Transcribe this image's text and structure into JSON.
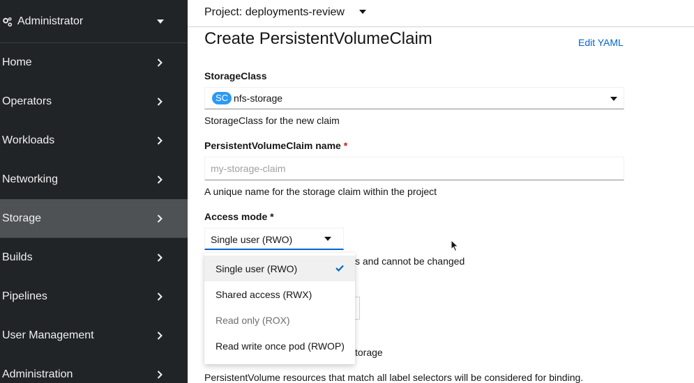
{
  "sidebar": {
    "perspective": {
      "label": "Administrator",
      "icon": "cog-icon"
    },
    "items": [
      {
        "label": "Home"
      },
      {
        "label": "Operators"
      },
      {
        "label": "Workloads"
      },
      {
        "label": "Networking"
      },
      {
        "label": "Storage",
        "active": true
      },
      {
        "label": "Builds"
      },
      {
        "label": "Pipelines"
      },
      {
        "label": "User Management"
      },
      {
        "label": "Administration"
      }
    ]
  },
  "topbar": {
    "project_label": "Project: deployments-review"
  },
  "page": {
    "title": "Create PersistentVolumeClaim",
    "edit_yaml": "Edit YAML"
  },
  "form": {
    "storage_class": {
      "label": "StorageClass",
      "badge": "SC",
      "value": "nfs-storage",
      "help": "StorageClass for the new claim"
    },
    "pvc_name": {
      "label": "PersistentVolumeClaim name",
      "required_mark": "*",
      "placeholder": "my-storage-claim",
      "help": "A unique name for the storage claim within the project"
    },
    "access_mode": {
      "label": "Access mode *",
      "value": "Single user (RWO)",
      "help_visible": "s and cannot be changed",
      "options": [
        {
          "label": "Single user (RWO)",
          "selected": true
        },
        {
          "label": "Shared access (RWX)"
        },
        {
          "label": "Read only (ROX)",
          "disabled": true
        },
        {
          "label": "Read write once pod (RWOP)"
        }
      ]
    },
    "partial_storage_text": "torage",
    "selector_help": "PersistentVolume resources that match all label selectors will be considered for binding."
  },
  "colors": {
    "sidebar_bg": "#212427",
    "sidebar_active": "#4f5255",
    "link": "#0066cc",
    "badge": "#2b9af3",
    "required": "#c9190b"
  }
}
